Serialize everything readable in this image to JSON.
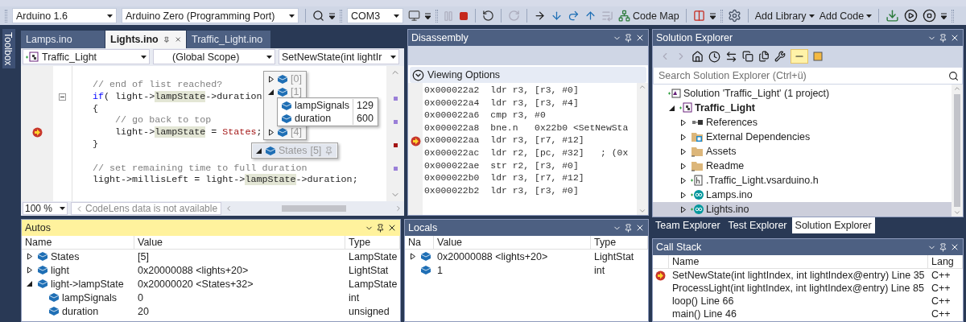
{
  "toolbar": {
    "board": "Arduino 1.6",
    "target": "Arduino Zero (Programming Port)",
    "port": "COM3",
    "code_map": "Code Map",
    "add_library": "Add Library",
    "add_code": "Add Code"
  },
  "toolbox_tab": "Toolbox",
  "editor": {
    "tabs": [
      {
        "label": "Lamps.ino",
        "selected": false
      },
      {
        "label": "Lights.ino",
        "selected": true
      },
      {
        "label": "Traffic_Light.ino",
        "selected": false
      }
    ],
    "nav": {
      "project": "Traffic_Light",
      "scope": "(Global Scope)",
      "member": "SetNewState(int lightIr"
    },
    "lines": [
      {
        "current": false,
        "foldable": false,
        "tokens": [
          {
            "kind": "comment",
            "text": "// end of list reached?"
          }
        ]
      },
      {
        "current": false,
        "foldable": true,
        "tokens": [
          {
            "kind": "keyword",
            "text": "if"
          },
          {
            "kind": "plain",
            "text": "( light->"
          },
          {
            "kind": "reference",
            "text": "lampState"
          },
          {
            "kind": "plain",
            "text": "->duration"
          }
        ]
      },
      {
        "current": false,
        "foldable": false,
        "tokens": [
          {
            "kind": "plain",
            "text": "{"
          }
        ]
      },
      {
        "current": false,
        "foldable": false,
        "tokens": [
          {
            "kind": "comment",
            "text": "    // go back to top"
          }
        ]
      },
      {
        "current": true,
        "foldable": false,
        "tokens": [
          {
            "kind": "plain",
            "text": "    light->"
          },
          {
            "kind": "reference",
            "text": "lampState"
          },
          {
            "kind": "plain",
            "text": " = "
          },
          {
            "kind": "global",
            "text": "States"
          },
          {
            "kind": "plain",
            "text": ";"
          }
        ]
      },
      {
        "current": false,
        "foldable": false,
        "tokens": [
          {
            "kind": "plain",
            "text": "}"
          }
        ]
      },
      {
        "current": false,
        "foldable": false
      },
      {
        "current": false,
        "foldable": false,
        "tokens": [
          {
            "kind": "comment",
            "text": "// set remaining time to full duration"
          }
        ]
      },
      {
        "current": false,
        "foldable": false,
        "tokens": [
          {
            "kind": "plain",
            "text": "light->millisLeft = light->"
          },
          {
            "kind": "reference",
            "text": "lampState"
          },
          {
            "kind": "plain",
            "text": "->duration;"
          }
        ]
      }
    ],
    "datatip": {
      "root": {
        "name": "States",
        "value": "[5]",
        "expanded": true
      },
      "elements": [
        {
          "name": "[0]",
          "expanded": false
        },
        {
          "name": "[1]",
          "expanded": true
        },
        {
          "name": "[4]",
          "expanded": false
        }
      ],
      "members": [
        {
          "name": "lampSignals",
          "value": "129"
        },
        {
          "name": "duration",
          "value": "600"
        }
      ]
    },
    "zoom": "100 %",
    "codelens": "CodeLens data is not available"
  },
  "disassembly": {
    "title": "Disassembly",
    "viewing_options": "Viewing Options",
    "lines": [
      {
        "address": "0x000022a2",
        "instruction": "ldr r3, [r3, #0]",
        "current": false
      },
      {
        "address": "0x000022a4",
        "instruction": "ldr r3, [r3, #4]",
        "current": false
      },
      {
        "address": "0x000022a6",
        "instruction": "cmp r3, #0",
        "current": false
      },
      {
        "address": "0x000022a8",
        "instruction": "bne.n   0x22b0 <SetNewSta",
        "current": false
      },
      {
        "address": "0x000022aa",
        "instruction": "ldr r3, [r7, #12]",
        "current": true
      },
      {
        "address": "0x000022ac",
        "instruction": "ldr r2, [pc, #32]   ; (0x",
        "current": false
      },
      {
        "address": "0x000022ae",
        "instruction": "str r2, [r3, #0]",
        "current": false
      },
      {
        "address": "0x000022b0",
        "instruction": "ldr r3, [r7, #12]",
        "current": false
      },
      {
        "address": "0x000022b2",
        "instruction": "ldr r3, [r3, #0]",
        "current": false
      }
    ]
  },
  "solution_explorer": {
    "title": "Solution Explorer",
    "search": {
      "placeholder": "Search Solution Explorer (Ctrl+ü)"
    },
    "tree": [
      {
        "kind": "solution",
        "label": "Solution 'Traffic_Light' (1 project)",
        "selected": false,
        "children": [
          {
            "kind": "project",
            "label": "Traffic_Light",
            "selected": false,
            "expanded": true,
            "children": [
              {
                "kind": "references",
                "label": "References",
                "selected": false,
                "expanded": false
              },
              {
                "kind": "filter",
                "label": "External Dependencies",
                "selected": false,
                "expanded": false
              },
              {
                "kind": "folder",
                "label": "Assets",
                "selected": false,
                "expanded": false
              },
              {
                "kind": "folder",
                "label": "Readme",
                "selected": false,
                "expanded": false
              },
              {
                "kind": "header",
                "label": ".Traffic_Light.vsarduino.h",
                "selected": false,
                "expanded": false
              },
              {
                "kind": "sketch",
                "label": "Lamps.ino",
                "selected": false,
                "expanded": false
              },
              {
                "kind": "sketch",
                "label": "Lights.ino",
                "selected": true,
                "expanded": false
              }
            ]
          }
        ]
      }
    ],
    "tabs": [
      {
        "label": "Team Explorer",
        "selected": false
      },
      {
        "label": "Test Explorer",
        "selected": false
      },
      {
        "label": "Solution Explorer",
        "selected": true
      }
    ]
  },
  "autos": {
    "title": "Autos",
    "active": true,
    "columns": [
      "Name",
      "Value",
      "Type"
    ],
    "rows": [
      {
        "name": "States",
        "value": "[5]",
        "type": "LampState",
        "expanded": false
      },
      {
        "name": "light",
        "value": "0x20000088 <lights+20>",
        "type": "LightStat",
        "expanded": false
      },
      {
        "name": "light->lampState",
        "value": "0x20000020 <States+32>",
        "type": "LampState",
        "expanded": true,
        "children": [
          {
            "name": "lampSignals",
            "value": "0",
            "type": "int"
          },
          {
            "name": "duration",
            "value": "20",
            "type": "unsigned"
          }
        ]
      }
    ]
  },
  "locals": {
    "title": "Locals",
    "active": false,
    "columns": [
      "Na",
      "Value",
      "Type"
    ],
    "rows": [
      {
        "value": "0x20000088 <lights+20>",
        "type": "LightStat",
        "expanded": false
      },
      {
        "value": "1",
        "type": "int"
      }
    ]
  },
  "call_stack": {
    "title": "Call Stack",
    "active": false,
    "columns": [
      "Name",
      "Lang"
    ],
    "rows": [
      {
        "name": "SetNewState(int lightIndex, int lightIndex@entry) Line 35",
        "lang": "C++",
        "current": true
      },
      {
        "name": "ProcessLight(int lightIndex, int lightIndex@entry) Line 85",
        "lang": "C++",
        "current": false
      },
      {
        "name": "loop() Line 66",
        "lang": "C++",
        "current": false
      },
      {
        "name": "main() Line 46",
        "lang": "C++",
        "current": false
      }
    ]
  }
}
